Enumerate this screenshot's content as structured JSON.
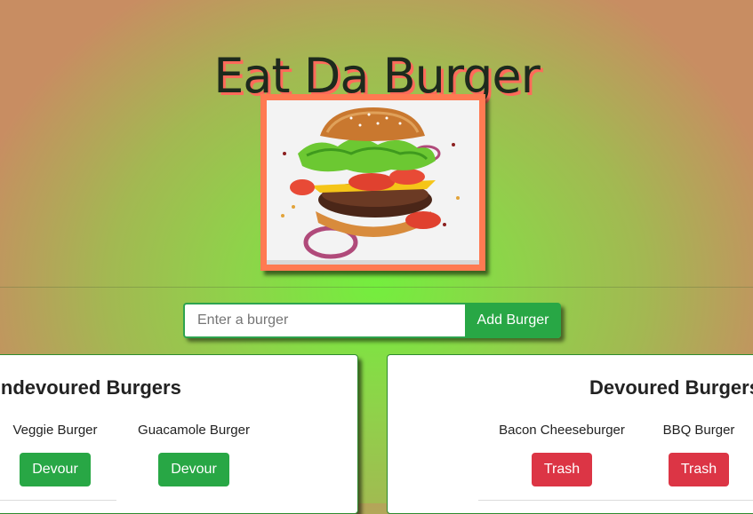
{
  "header": {
    "title": "Eat Da Burger"
  },
  "form": {
    "placeholder": "Enter a burger",
    "submit_label": "Add Burger"
  },
  "undevoured": {
    "title": "Undevoured Burgers",
    "items": [
      {
        "name": "Veggie Burger",
        "action": "Devour"
      },
      {
        "name": "Guacamole Burger",
        "action": "Devour"
      }
    ]
  },
  "devoured": {
    "title": "Devoured Burgers",
    "items": [
      {
        "name": "Bacon Cheeseburger",
        "action": "Trash"
      },
      {
        "name": "BBQ Burger",
        "action": "Trash"
      }
    ]
  },
  "colors": {
    "accent_green": "#28a745",
    "danger_red": "#dc3545",
    "frame_orange": "#ff7a52"
  }
}
